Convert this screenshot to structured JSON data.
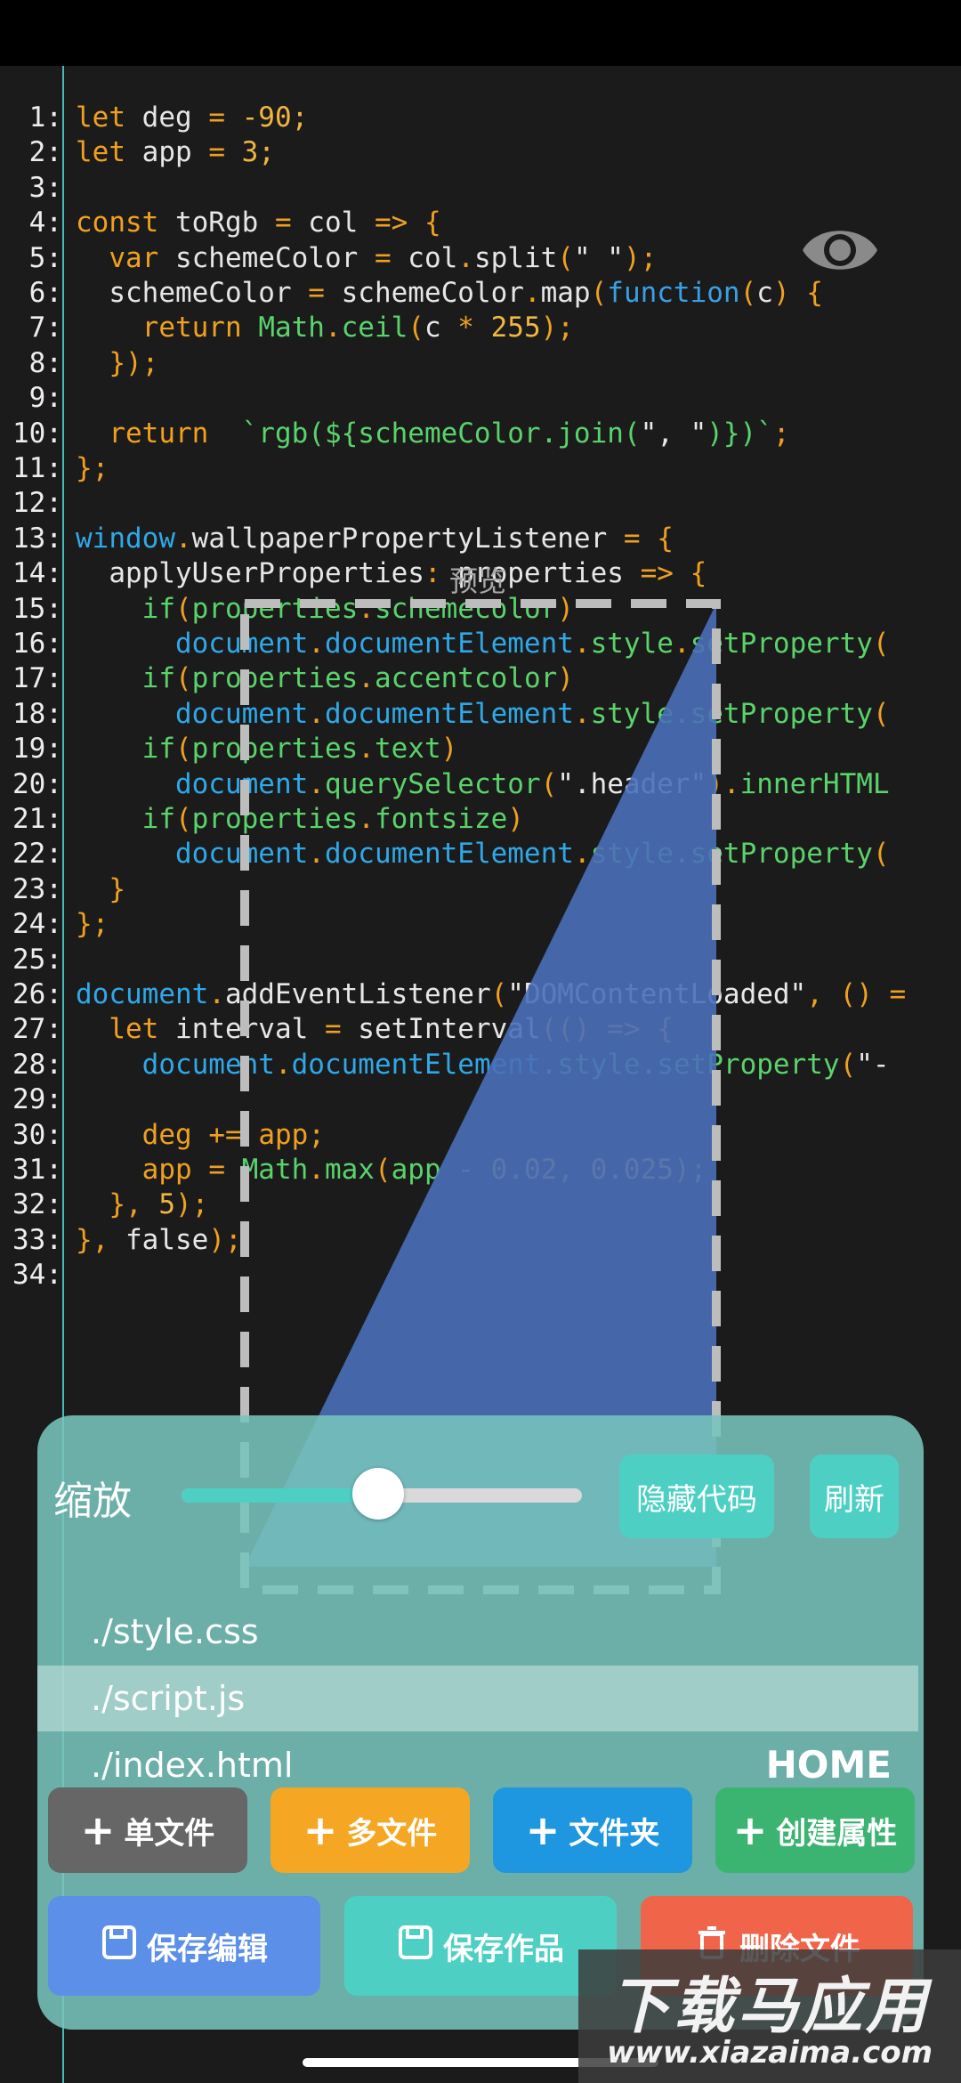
{
  "code_lines": [
    {
      "n": "1:",
      "segs": [
        [
          "kw",
          "let "
        ],
        [
          "",
          "deg "
        ],
        [
          "punc",
          "= "
        ],
        [
          "num",
          "-90;"
        ]
      ]
    },
    {
      "n": "2:",
      "segs": [
        [
          "kw",
          "let "
        ],
        [
          "",
          "app "
        ],
        [
          "punc",
          "= "
        ],
        [
          "num",
          "3;"
        ]
      ]
    },
    {
      "n": "3:",
      "segs": []
    },
    {
      "n": "4:",
      "segs": [
        [
          "kw",
          "const "
        ],
        [
          "",
          "toRgb "
        ],
        [
          "punc",
          "= "
        ],
        [
          "",
          "col "
        ],
        [
          "punc",
          "=> {"
        ]
      ]
    },
    {
      "n": "5:",
      "segs": [
        [
          "",
          "  "
        ],
        [
          "kw",
          "var "
        ],
        [
          "",
          "schemeColor "
        ],
        [
          "punc",
          "= "
        ],
        [
          "",
          "col"
        ],
        [
          "punc",
          "."
        ],
        [
          "",
          "split"
        ],
        [
          "punc",
          "("
        ],
        [
          "str",
          "\" \""
        ],
        [
          "punc",
          ");"
        ]
      ]
    },
    {
      "n": "6:",
      "segs": [
        [
          "",
          "  schemeColor "
        ],
        [
          "punc",
          "= "
        ],
        [
          "",
          "schemeColor"
        ],
        [
          "punc",
          "."
        ],
        [
          "",
          "map"
        ],
        [
          "punc",
          "("
        ],
        [
          "fn",
          "function"
        ],
        [
          "punc",
          "("
        ],
        [
          "",
          "c"
        ],
        [
          "punc",
          ") {"
        ]
      ]
    },
    {
      "n": "7:",
      "segs": [
        [
          "",
          "    "
        ],
        [
          "kw",
          "return "
        ],
        [
          "prop",
          "Math"
        ],
        [
          "punc",
          "."
        ],
        [
          "prop",
          "ceil"
        ],
        [
          "punc",
          "("
        ],
        [
          "",
          "c "
        ],
        [
          "punc",
          "* "
        ],
        [
          "num",
          "255"
        ],
        [
          "punc",
          ");"
        ]
      ]
    },
    {
      "n": "8:",
      "segs": [
        [
          "punc",
          "  });"
        ]
      ]
    },
    {
      "n": "9:",
      "segs": []
    },
    {
      "n": "10:",
      "segs": [
        [
          "",
          "  "
        ],
        [
          "kw",
          "return  "
        ],
        [
          "prop",
          "`rgb(${schemeColor.join("
        ],
        [
          "str",
          "\", \""
        ],
        [
          "prop",
          ")})`"
        ],
        [
          "punc",
          ";"
        ]
      ]
    },
    {
      "n": "11:",
      "segs": [
        [
          "punc",
          "};"
        ]
      ]
    },
    {
      "n": "12:",
      "segs": []
    },
    {
      "n": "13:",
      "segs": [
        [
          "obj",
          "window"
        ],
        [
          "punc",
          "."
        ],
        [
          "",
          "wallpaperPropertyListener "
        ],
        [
          "punc",
          "= {"
        ]
      ]
    },
    {
      "n": "14:",
      "segs": [
        [
          "",
          "  applyUserProperties"
        ],
        [
          "punc",
          ": "
        ],
        [
          "",
          "properties "
        ],
        [
          "punc",
          "=> {"
        ]
      ]
    },
    {
      "n": "15:",
      "segs": [
        [
          "",
          "    "
        ],
        [
          "prop",
          "if"
        ],
        [
          "punc",
          "("
        ],
        [
          "prop",
          "properties"
        ],
        [
          "punc",
          "."
        ],
        [
          "prop",
          "schemecolor"
        ],
        [
          "punc",
          ")"
        ]
      ]
    },
    {
      "n": "16:",
      "segs": [
        [
          "",
          "      "
        ],
        [
          "obj",
          "document"
        ],
        [
          "punc",
          "."
        ],
        [
          "obj",
          "documentElement"
        ],
        [
          "punc",
          "."
        ],
        [
          "prop",
          "style"
        ],
        [
          "punc",
          "."
        ],
        [
          "prop",
          "setProperty"
        ],
        [
          "punc",
          "("
        ]
      ]
    },
    {
      "n": "17:",
      "segs": [
        [
          "",
          "    "
        ],
        [
          "prop",
          "if"
        ],
        [
          "punc",
          "("
        ],
        [
          "prop",
          "properties"
        ],
        [
          "punc",
          "."
        ],
        [
          "prop",
          "accentcolor"
        ],
        [
          "punc",
          ")"
        ]
      ]
    },
    {
      "n": "18:",
      "segs": [
        [
          "",
          "      "
        ],
        [
          "obj",
          "document"
        ],
        [
          "punc",
          "."
        ],
        [
          "obj",
          "documentElement"
        ],
        [
          "punc",
          "."
        ],
        [
          "prop",
          "style"
        ],
        [
          "punc",
          "."
        ],
        [
          "prop",
          "setProperty"
        ],
        [
          "punc",
          "("
        ]
      ]
    },
    {
      "n": "19:",
      "segs": [
        [
          "",
          "    "
        ],
        [
          "prop",
          "if"
        ],
        [
          "punc",
          "("
        ],
        [
          "prop",
          "properties"
        ],
        [
          "punc",
          "."
        ],
        [
          "prop",
          "text"
        ],
        [
          "punc",
          ")"
        ]
      ]
    },
    {
      "n": "20:",
      "segs": [
        [
          "",
          "      "
        ],
        [
          "obj",
          "document"
        ],
        [
          "punc",
          "."
        ],
        [
          "prop",
          "querySelector"
        ],
        [
          "punc",
          "("
        ],
        [
          "str",
          "\".header\""
        ],
        [
          "punc",
          ")."
        ],
        [
          "prop",
          "innerHTML"
        ]
      ]
    },
    {
      "n": "21:",
      "segs": [
        [
          "",
          "    "
        ],
        [
          "prop",
          "if"
        ],
        [
          "punc",
          "("
        ],
        [
          "prop",
          "properties"
        ],
        [
          "punc",
          "."
        ],
        [
          "prop",
          "fontsize"
        ],
        [
          "punc",
          ")"
        ]
      ]
    },
    {
      "n": "22:",
      "segs": [
        [
          "",
          "      "
        ],
        [
          "obj",
          "document"
        ],
        [
          "punc",
          "."
        ],
        [
          "obj",
          "documentElement"
        ],
        [
          "punc",
          "."
        ],
        [
          "prop",
          "style"
        ],
        [
          "punc",
          "."
        ],
        [
          "prop",
          "setProperty"
        ],
        [
          "punc",
          "("
        ]
      ]
    },
    {
      "n": "23:",
      "segs": [
        [
          "punc",
          "  }"
        ]
      ]
    },
    {
      "n": "24:",
      "segs": [
        [
          "punc",
          "};"
        ]
      ]
    },
    {
      "n": "25:",
      "segs": []
    },
    {
      "n": "26:",
      "segs": [
        [
          "obj",
          "document"
        ],
        [
          "punc",
          "."
        ],
        [
          "",
          "addEventListener"
        ],
        [
          "punc",
          "("
        ],
        [
          "str",
          "\"DOMContentLoaded\""
        ],
        [
          "punc",
          ", () ="
        ]
      ]
    },
    {
      "n": "27:",
      "segs": [
        [
          "",
          "  "
        ],
        [
          "kw",
          "let "
        ],
        [
          "",
          "interval "
        ],
        [
          "punc",
          "= "
        ],
        [
          "",
          "setInterval"
        ],
        [
          "punc",
          "(() => {"
        ]
      ]
    },
    {
      "n": "28:",
      "segs": [
        [
          "",
          "    "
        ],
        [
          "obj",
          "document"
        ],
        [
          "punc",
          "."
        ],
        [
          "obj",
          "documentElement"
        ],
        [
          "punc",
          "."
        ],
        [
          "prop",
          "style"
        ],
        [
          "punc",
          "."
        ],
        [
          "prop",
          "setProperty"
        ],
        [
          "punc",
          "("
        ],
        [
          "str",
          "\"-"
        ]
      ]
    },
    {
      "n": "29:",
      "segs": []
    },
    {
      "n": "30:",
      "segs": [
        [
          "",
          "    "
        ],
        [
          "kw",
          "deg "
        ],
        [
          "punc",
          "+= "
        ],
        [
          "kw",
          "app"
        ],
        [
          "punc",
          ";"
        ]
      ]
    },
    {
      "n": "31:",
      "segs": [
        [
          "",
          "    "
        ],
        [
          "kw",
          "app "
        ],
        [
          "punc",
          "= "
        ],
        [
          "prop",
          "Math"
        ],
        [
          "punc",
          "."
        ],
        [
          "prop",
          "max"
        ],
        [
          "punc",
          "("
        ],
        [
          "prop",
          "app "
        ],
        [
          "punc",
          "- "
        ],
        [
          "num",
          "0.02"
        ],
        [
          "punc",
          ", "
        ],
        [
          "num",
          "0.025"
        ],
        [
          "punc",
          ");"
        ]
      ]
    },
    {
      "n": "32:",
      "segs": [
        [
          "punc",
          "  }, "
        ],
        [
          "num",
          "5"
        ],
        [
          "punc",
          ");"
        ]
      ]
    },
    {
      "n": "33:",
      "segs": [
        [
          "punc",
          "}, "
        ],
        [
          "",
          "false"
        ],
        [
          "punc",
          ");"
        ]
      ]
    },
    {
      "n": "34:",
      "segs": []
    }
  ],
  "preview": {
    "label": "预览",
    "fill_color": "#4a6fb8"
  },
  "panel": {
    "zoom_label": "缩放",
    "zoom_level": 0.49,
    "hide_code_label": "隐藏代码",
    "refresh_label": "刷新",
    "files": [
      {
        "name": "./style.css",
        "selected": false,
        "badge": ""
      },
      {
        "name": "./script.js",
        "selected": true,
        "badge": ""
      },
      {
        "name": "./index.html",
        "selected": false,
        "badge": "HOME"
      }
    ],
    "buttons_row1": [
      {
        "label": "单文件",
        "icon": "plus-icon",
        "color": "#666666"
      },
      {
        "label": "多文件",
        "icon": "plus-icon",
        "color": "#f5a623"
      },
      {
        "label": "文件夹",
        "icon": "plus-icon",
        "color": "#1e96e0"
      },
      {
        "label": "创建属性",
        "icon": "plus-icon",
        "color": "#3bb371"
      }
    ],
    "buttons_row2": [
      {
        "label": "保存编辑",
        "icon": "save-icon",
        "color": "#5b8fe8"
      },
      {
        "label": "保存作品",
        "icon": "save-icon",
        "color": "#4dd0c3"
      },
      {
        "label": "删除文件",
        "icon": "trash-icon",
        "color": "#f06449"
      }
    ]
  },
  "watermark": {
    "title": "下载马应用",
    "url": "www.xiazaima.com"
  }
}
